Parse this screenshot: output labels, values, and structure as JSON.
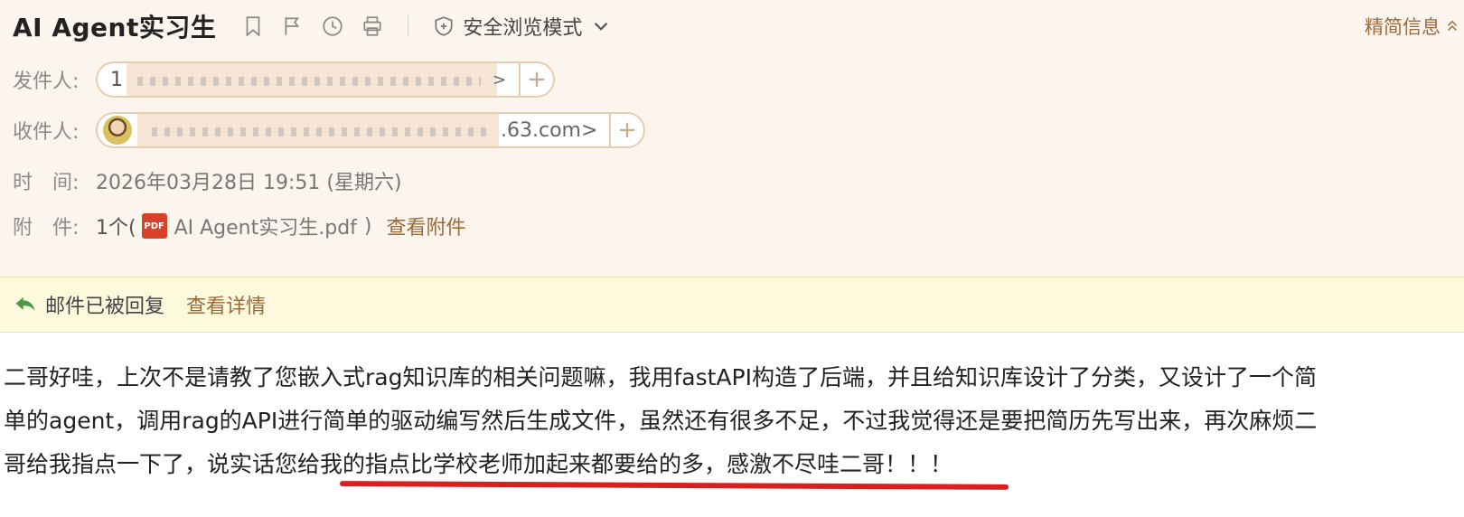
{
  "header": {
    "title": "AI Agent实习生",
    "toolbar_icons": [
      "bookmark-icon",
      "flag-icon",
      "clock-icon",
      "print-icon"
    ],
    "safe_mode_label": "安全浏览模式",
    "simplify_label": "精简信息"
  },
  "meta": {
    "sender_label": "发件人:",
    "sender_visible": "1",
    "sender_suffix": ">",
    "recipient_label": "收件人:",
    "recipient_suffix": ".63.com>",
    "time_label": "时　间:",
    "time_value": "2026年03月28日 19:51 (星期六)",
    "attach_label": "附　件:",
    "attach_count": "1个(",
    "attach_file": "AI Agent实习生.pdf",
    "attach_close": ")",
    "attach_link": "查看附件",
    "pdf_badge": "PDF"
  },
  "notice": {
    "text": "邮件已被回复",
    "link": "查看详情"
  },
  "body": {
    "line1": "二哥好哇，上次不是请教了您嵌入式rag知识库的相关问题嘛，我用fastAPI构造了后端，并且给知识库设计了分类，又设计了一个简",
    "line2": "单的agent，调用rag的API进行简单的驱动编写然后生成文件，虽然还有很多不足，不过我觉得还是要把简历先写出来，再次麻烦二",
    "line3": "哥给我指点一下了，说实话您给我的指点比学校老师加起来都要给的多，感激不尽哇二哥！！！"
  },
  "colors": {
    "header_bg": "#fcf5ee",
    "notice_bg": "#fdf9dc",
    "link": "#9a6a3a",
    "underline": "#d82020"
  }
}
